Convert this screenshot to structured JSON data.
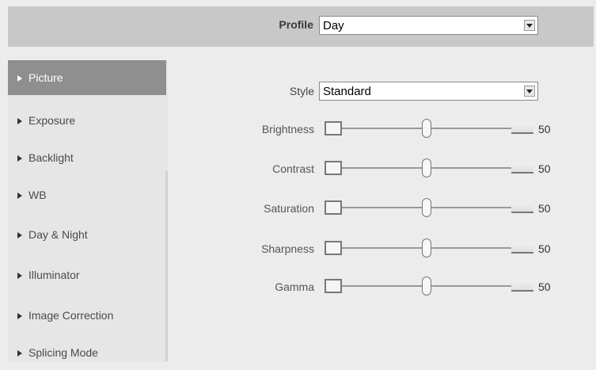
{
  "profile": {
    "label": "Profile",
    "value": "Day"
  },
  "sidebar": {
    "items": [
      {
        "label": "Picture",
        "active": true
      },
      {
        "label": "Exposure",
        "active": false
      },
      {
        "label": "Backlight",
        "active": false
      },
      {
        "label": "WB",
        "active": false
      },
      {
        "label": "Day & Night",
        "active": false
      },
      {
        "label": "Illuminator",
        "active": false
      },
      {
        "label": "Image Correction",
        "active": false
      },
      {
        "label": "Splicing Mode",
        "active": false
      }
    ]
  },
  "picture": {
    "style": {
      "label": "Style",
      "value": "Standard"
    },
    "sliders": [
      {
        "label": "Brightness",
        "value": "50",
        "level": 0.5
      },
      {
        "label": "Contrast",
        "value": "50",
        "level": 0.5
      },
      {
        "label": "Saturation",
        "value": "50",
        "level": 0.5
      },
      {
        "label": "Sharpness",
        "value": "50",
        "level": 0.5
      },
      {
        "label": "Gamma",
        "value": "50",
        "level": 0.5
      }
    ]
  }
}
